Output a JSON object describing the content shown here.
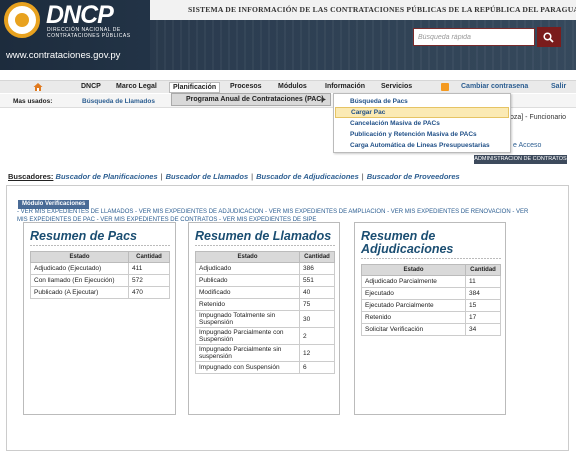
{
  "header": {
    "logo": "DNCP",
    "logo_sub_1": "Dirección Nacional de",
    "logo_sub_2": "Contrataciones Públicas",
    "site_url": "www.contrataciones.gov.py",
    "site_title": "SISTEMA DE INFORMACIÓN DE LAS CONTRATACIONES PÚBLICAS DE LA REPÚBLICA DEL PARAGUAY",
    "search_placeholder": "Búsqueda rápida"
  },
  "nav": {
    "items": [
      "DNCP",
      "Marco Legal",
      "Planificación",
      "Procesos",
      "Módulos",
      "Información",
      "Servicios"
    ],
    "change_password": "Cambiar contrasena",
    "logout": "Salir"
  },
  "used": {
    "label": "Mas usados:",
    "link": "Búsqueda de Llamados"
  },
  "dropdown": {
    "level1": "Programa Anual de Contrataciones (PAC)",
    "level2": [
      "Búsqueda de Pacs",
      "Cargar Pac",
      "Cancelación Masiva de PACs",
      "Publicación y Retención Masiva de PACs",
      "Carga Automática de Lineas Presupuestarias"
    ]
  },
  "hidden": {
    "right_text": "oza] - Funcionario",
    "acceso": "e Acceso",
    "admin_button": "ADMINISTRACION DE CONTRATOS"
  },
  "buscadores": {
    "label": "Buscadores:",
    "links": [
      "Buscador de Planificaciones",
      "Buscador de Llamados",
      "Buscador de Adjudicaciones",
      "Buscador de Proveedores"
    ]
  },
  "module": {
    "badge": "Módulo Verificaciones",
    "links_line1": "- VER MIS EXPEDIENTES DE LLAMADOS - VER MIS EXPEDIENTES DE ADJUDICACION - VER MIS EXPEDIENTES DE AMPLIACION - VER MIS EXPEDIENTES DE RENOVACION - VER",
    "links_line2": "MIS EXPEDIENTES DE PAC - VER MIS EXPEDIENTES DE CONTRATOS - VER MIS EXPEDIENTES DE SIPE"
  },
  "resumen_pacs": {
    "title": "Resumen de Pacs",
    "headers": [
      "Estado",
      "Cantidad"
    ],
    "rows": [
      [
        "Adjudicado (Ejecutado)",
        "411"
      ],
      [
        "Con llamado (En Ejecución)",
        "572"
      ],
      [
        "Publicado (A Ejecutar)",
        "470"
      ]
    ]
  },
  "resumen_llamados": {
    "title": "Resumen de Llamados",
    "headers": [
      "Estado",
      "Cantidad"
    ],
    "rows": [
      [
        "Adjudicado",
        "386"
      ],
      [
        "Publicado",
        "551"
      ],
      [
        "Modificado",
        "40"
      ],
      [
        "Retenido",
        "75"
      ],
      [
        "Impugnado Totalmente sin Suspensión",
        "30"
      ],
      [
        "Impugnado Parcialmente con Suspensión",
        "2"
      ],
      [
        "Impugnado Parcialmente sin suspensión",
        "12"
      ],
      [
        "Impugnado con Suspensión",
        "6"
      ]
    ]
  },
  "resumen_adjudicaciones": {
    "title_1": "Resumen de",
    "title_2": "Adjudicaciones",
    "headers": [
      "Estado",
      "Cantidad"
    ],
    "rows": [
      [
        "Adjudicado Parcialmente",
        "11"
      ],
      [
        "Ejecutado",
        "384"
      ],
      [
        "Ejecutado Parcialmente",
        "15"
      ],
      [
        "Retenido",
        "17"
      ],
      [
        "Solicitar Verificación",
        "34"
      ]
    ]
  }
}
